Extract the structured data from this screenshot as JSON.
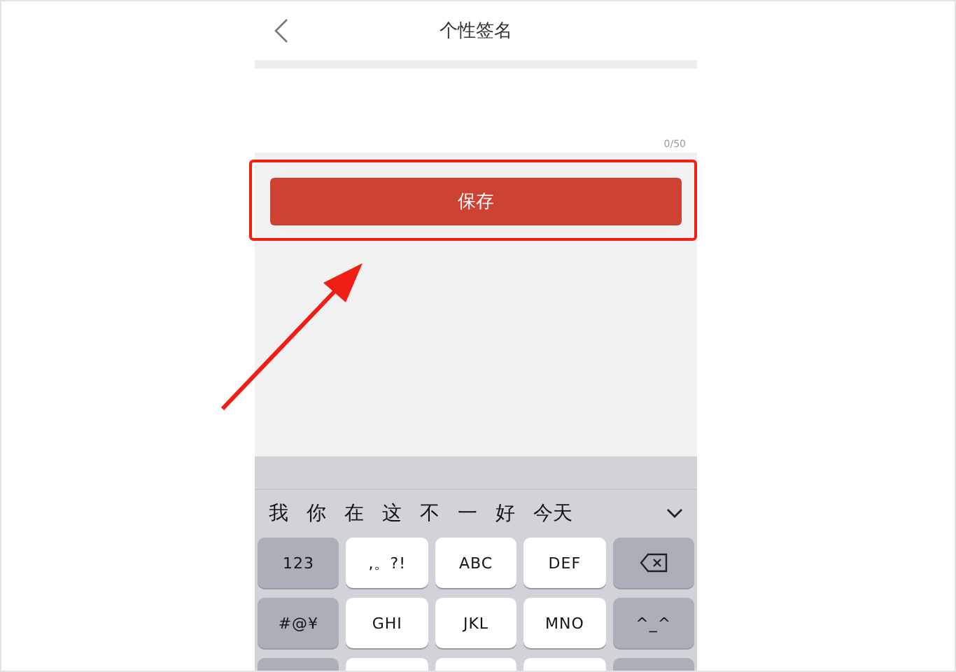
{
  "header": {
    "title": "个性签名"
  },
  "signature_field": {
    "counter": "0/50"
  },
  "save_button": {
    "label": "保存"
  },
  "candidates": [
    "我",
    "你",
    "在",
    "这",
    "不",
    "一",
    "好",
    "今天"
  ],
  "key_rows": [
    [
      {
        "label": "123",
        "kind": "function"
      },
      {
        "label": ",。?!",
        "kind": "letter"
      },
      {
        "label": "ABC",
        "kind": "letter"
      },
      {
        "label": "DEF",
        "kind": "letter"
      },
      {
        "kind": "delete"
      }
    ],
    [
      {
        "label": "#@¥",
        "kind": "function"
      },
      {
        "label": "GHI",
        "kind": "letter"
      },
      {
        "label": "JKL",
        "kind": "letter"
      },
      {
        "label": "MNO",
        "kind": "letter"
      },
      {
        "label": "^_^",
        "kind": "function"
      }
    ]
  ]
}
